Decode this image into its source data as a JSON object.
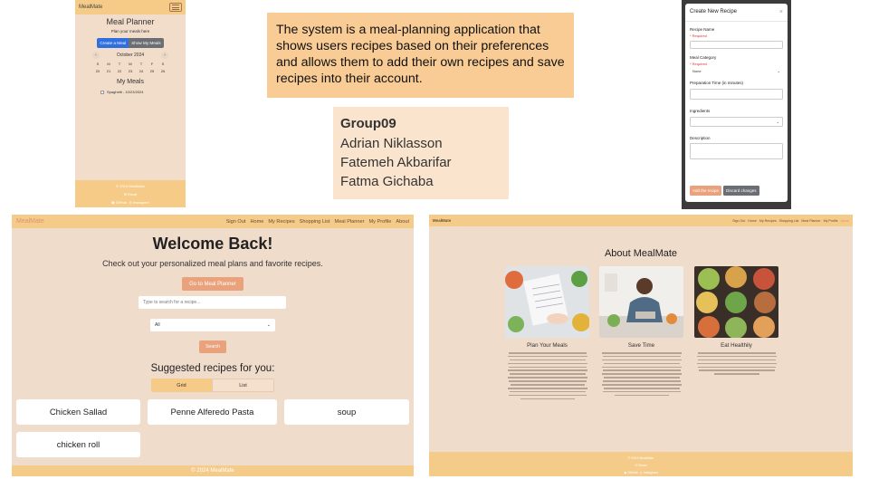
{
  "mobile": {
    "brand": "MealMate",
    "title": "Meal Planner",
    "subtitle": "Plan your meals here",
    "create_button": "Create a Meal",
    "show_button": "Show My Meals",
    "calendar": {
      "month": "October 2024",
      "prev": "‹",
      "next": "›",
      "weekdays": [
        "S",
        "M",
        "T",
        "W",
        "T",
        "F",
        "S"
      ],
      "days": [
        "20",
        "21",
        "22",
        "23",
        "24",
        "25",
        "26"
      ]
    },
    "my_meals_title": "My Meals",
    "meal_item": "Spaghetti - 10/23/2024",
    "footer": {
      "copyright": "© 2024 MealMate",
      "email": "Email",
      "github": "GitHub",
      "instagram": "Instagram"
    }
  },
  "description": "The system is a meal-planning application that shows users recipes based on their preferences and allows them to add their own recipes and save recipes into their account.",
  "group": {
    "name": "Group09",
    "members": [
      "Adrian Niklasson",
      "Fatemeh Akbarifar",
      "Fatma Gichaba"
    ]
  },
  "modal": {
    "title": "Create New Recipe",
    "close": "×",
    "recipe_name_label": "Recipe Name",
    "required": "* Required",
    "category_label": "Meal Category",
    "category_value": "None",
    "prep_label": "Preparation Time (in minutes)",
    "ingredients_label": "Ingredients",
    "description_label": "Description",
    "add_button": "Add the recipe",
    "discard_button": "Discard changes"
  },
  "home": {
    "brand": "MealMate",
    "nav": [
      "Sign Out",
      "Home",
      "My Recipes",
      "Shopping List",
      "Meal Planner",
      "My Profile",
      "About"
    ],
    "heading": "Welcome Back!",
    "intro": "Check out your personalized meal plans and favorite recipes.",
    "planner_button": "Go to Meal Planner",
    "search_placeholder": "Type to search for a recipe...",
    "filter_value": "All",
    "search_button": "Search",
    "suggested_title": "Suggested recipes for you:",
    "tab_grid": "Grid",
    "tab_list": "List",
    "recipes": [
      "Chicken Sallad",
      "Penne Alferedo Pasta",
      "soup",
      "chicken roll"
    ],
    "footer": "© 2024 MealMate"
  },
  "about": {
    "brand": "MealMate",
    "nav": [
      "Sign Out",
      "Home",
      "My Recipes",
      "Shopping List",
      "Meal Planner",
      "My Profile",
      "About"
    ],
    "title": "About MealMate",
    "columns": [
      {
        "title": "Plan Your Meals"
      },
      {
        "title": "Save Time"
      },
      {
        "title": "Eat Healthily"
      }
    ],
    "footer": {
      "copyright": "© 2024 MealMate",
      "email": "Email",
      "github": "GitHub",
      "instagram": "Instagram"
    }
  },
  "colors": {
    "navbar": "#f5cb8a",
    "page_bg": "#f0dccb",
    "accent_button": "#e9a27b",
    "primary_blue": "#2f6fe0",
    "description_bg": "#f9cc95",
    "group_bg": "#fbe4cd"
  }
}
